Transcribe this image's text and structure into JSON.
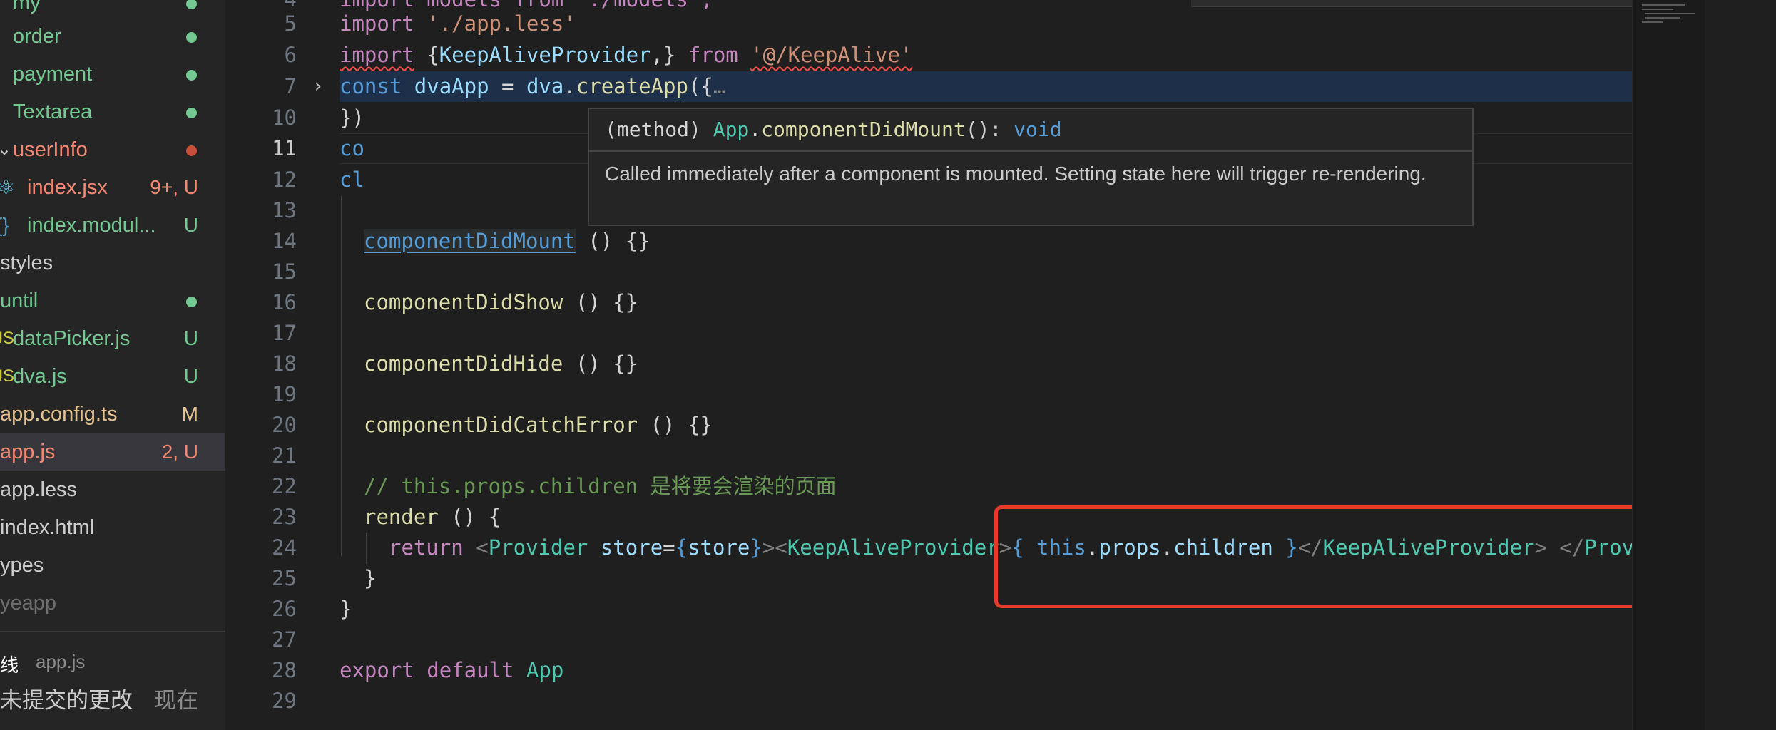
{
  "explorer": {
    "items": [
      {
        "label": "my",
        "type": "folder",
        "color": "green"
      },
      {
        "label": "order",
        "type": "folder",
        "color": "green"
      },
      {
        "label": "payment",
        "type": "folder",
        "color": "green"
      },
      {
        "label": "Textarea",
        "type": "folder",
        "color": "green"
      },
      {
        "label": "userInfo",
        "type": "folder",
        "color": "red"
      },
      {
        "label": "index.jsx",
        "icon": "react-icon",
        "status": "9+, U",
        "color": "red"
      },
      {
        "label": "index.modul...",
        "icon": "braces-icon",
        "status": "U",
        "color": "green"
      },
      {
        "label": "styles",
        "type": "folder",
        "color": "white"
      },
      {
        "label": "until",
        "type": "folder",
        "color": "green"
      },
      {
        "label": "dataPicker.js",
        "icon": "js-icon",
        "status": "U",
        "color": "green"
      },
      {
        "label": "dva.js",
        "icon": "js-icon",
        "status": "U",
        "color": "green"
      },
      {
        "label": "app.config.ts",
        "status": "M",
        "color": "yellow"
      },
      {
        "label": "app.js",
        "status": "2, U",
        "color": "red"
      },
      {
        "label": "app.less",
        "color": "white"
      },
      {
        "label": "index.html",
        "color": "white"
      },
      {
        "label": "ypes",
        "color": "white"
      },
      {
        "label": "yeapp",
        "color": "grey"
      }
    ]
  },
  "timeline": {
    "title": "线",
    "file": "app.js",
    "entry": "未提交的更改",
    "time": "现在"
  },
  "editor": {
    "line_numbers": [
      "4",
      "5",
      "6",
      "7",
      "10",
      "11",
      "12",
      "13",
      "14",
      "15",
      "16",
      "17",
      "18",
      "19",
      "20",
      "21",
      "22",
      "23",
      "24",
      "25",
      "26",
      "27",
      "28",
      "29"
    ],
    "current_line": "11",
    "code": {
      "l4": "import models from './models';",
      "l5_kw": "import",
      "l5_str": "'./app.less'",
      "l6_kw": "import",
      "l6_a": "{",
      "l6_b": "KeepAliveProvider",
      "l6_c": ",} ",
      "l6_from": "from",
      "l6_str": "'@/KeepAlive'",
      "l7_kw": "const",
      "l7_var": "dvaApp",
      "l7_eq": " = ",
      "l7_obj": "dva",
      "l7_dot": ".",
      "l7_fn": "createApp",
      "l7_end": "({",
      "l7_ell": "…",
      "l10": "})",
      "l11": "co",
      "l12": "cl",
      "l14_fn": "componentDidMount",
      "l14_rest": " () {}",
      "l16_fn": "componentDidShow",
      "l16_rest": " () {}",
      "l18_fn": "componentDidHide",
      "l18_rest": " () {}",
      "l20_fn": "componentDidCatchError",
      "l20_rest": " () {}",
      "l22": "// this.props.children 是将要会渲染的页面",
      "l23_fn": "render",
      "l23_rest": " () {",
      "l24_kw": "return",
      "l24_lt1": "<",
      "l24_prov": "Provider",
      "l24_attr": " store",
      "l24_eq": "=",
      "l24_b1": "{",
      "l24_store": "store",
      "l24_b2": "}",
      "l24_gt1": ">",
      "l24_lt2": "<",
      "l24_kap": "KeepAliveProvider",
      "l24_gt2": ">",
      "l24_b3": "{ ",
      "l24_this": "this",
      "l24_d1": ".",
      "l24_props": "props",
      "l24_d2": ".",
      "l24_children": "children",
      "l24_b4": " }",
      "l24_lt3": "</",
      "l24_kap2": "KeepAliveProvider",
      "l24_gt3": ">",
      "l24_sp": " ",
      "l24_lt4": "</",
      "l24_prov2": "Provider",
      "l24_gt4": ">",
      "l25": "}",
      "l26": "}",
      "l28_kw": "export",
      "l28_kw2": "default",
      "l28_cls": "App"
    }
  },
  "hover": {
    "sig_open": "(method) ",
    "sig_class": "App",
    "sig_dot": ".",
    "sig_fn": "componentDidMount",
    "sig_mid": "(): ",
    "sig_type": "void",
    "doc": "Called immediately after a component is mounted. Setting state here will trigger re-rendering."
  },
  "colors": {
    "annotation_box": "#e5392a",
    "git_untracked": "#73c991",
    "git_error": "#f48771",
    "git_modified": "#e2c08d"
  }
}
